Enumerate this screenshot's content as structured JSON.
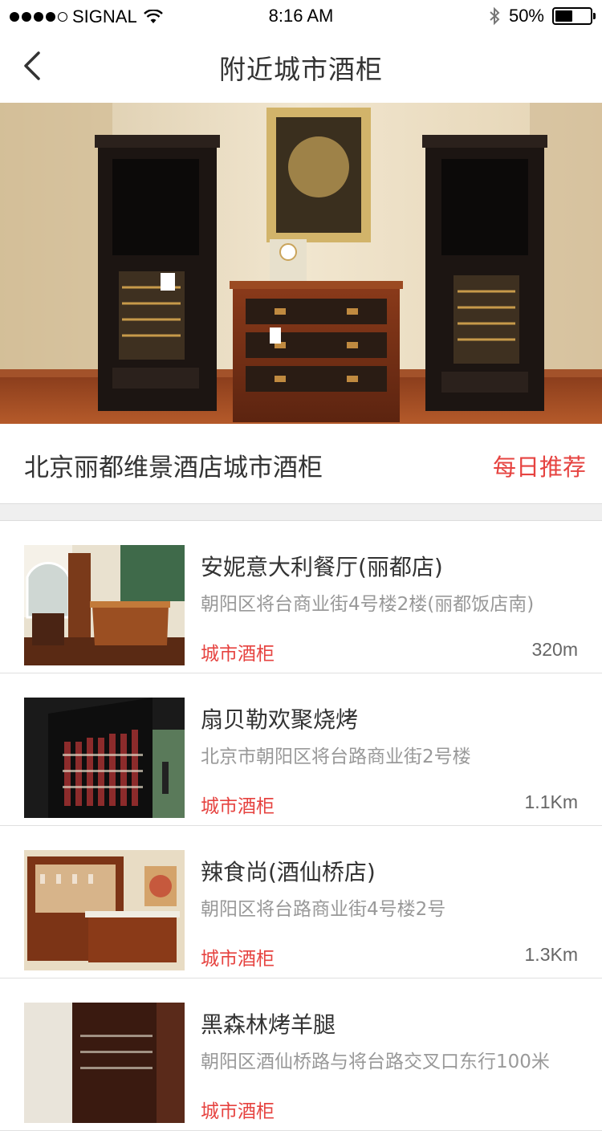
{
  "status_bar": {
    "carrier": "SIGNAL",
    "time": "8:16 AM",
    "battery_percent": "50%",
    "battery_level": 0.5,
    "icons": [
      "signal-dots-icon",
      "wifi-icon",
      "bluetooth-icon",
      "battery-icon"
    ]
  },
  "nav": {
    "title": "附近城市酒柜",
    "back_icon": "chevron-left-icon"
  },
  "hero": {
    "image": "wine-cabinet-showroom-photo"
  },
  "featured": {
    "title": "北京丽都维景酒店城市酒柜",
    "tag": "每日推荐"
  },
  "accent_color": "#e64340",
  "items": [
    {
      "name": "安妮意大利餐厅(丽都店)",
      "address": "朝阳区将台商业街4号楼2楼(丽都饭店南)",
      "tag": "城市酒柜",
      "distance": "320m"
    },
    {
      "name": "扇贝勒欢聚烧烤",
      "address": "北京市朝阳区将台路商业街2号楼",
      "tag": "城市酒柜",
      "distance": "1.1Km"
    },
    {
      "name": "辣食尚(酒仙桥店)",
      "address": "朝阳区将台路商业街4号楼2号",
      "tag": "城市酒柜",
      "distance": "1.3Km"
    },
    {
      "name": "黑森林烤羊腿",
      "address": "朝阳区酒仙桥路与将台路交叉口东行100米",
      "tag": "城市酒柜",
      "distance": ""
    }
  ]
}
